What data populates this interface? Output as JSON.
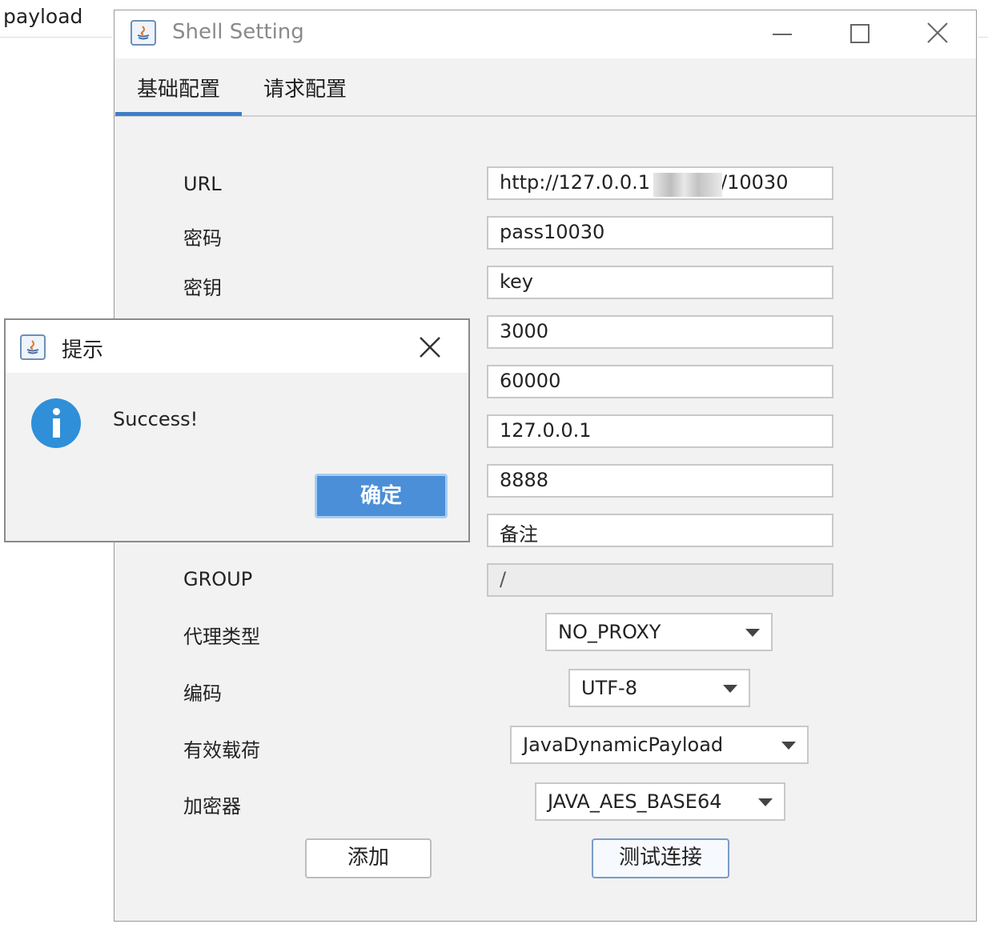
{
  "background": {
    "label": "payload"
  },
  "window": {
    "title": "Shell Setting",
    "tabs": [
      {
        "label": "基础配置",
        "active": true
      },
      {
        "label": "请求配置",
        "active": false
      }
    ]
  },
  "form": {
    "fields": [
      {
        "label": "URL",
        "value_prefix": "http://127.0.0.1",
        "value_suffix": "/10030"
      },
      {
        "label": "密码",
        "value": "pass10030"
      },
      {
        "label": "密钥",
        "value": "key"
      },
      {
        "label": "",
        "value": "3000"
      },
      {
        "label": "",
        "value": "60000"
      },
      {
        "label": "",
        "value": "127.0.0.1"
      },
      {
        "label": "",
        "value": "8888"
      },
      {
        "label": "",
        "value": "备注"
      },
      {
        "label": "GROUP",
        "value": "/"
      }
    ],
    "selects": [
      {
        "label": "代理类型",
        "value": "NO_PROXY"
      },
      {
        "label": "编码",
        "value": "UTF-8"
      },
      {
        "label": "有效载荷",
        "value": "JavaDynamicPayload"
      },
      {
        "label": "加密器",
        "value": "JAVA_AES_BASE64"
      }
    ],
    "buttons": {
      "add": "添加",
      "test": "测试连接"
    }
  },
  "dialog": {
    "title": "提示",
    "message": "Success!",
    "ok": "确定"
  },
  "colors": {
    "accent": "#3d7ec7",
    "ok_button": "#4a8fd8",
    "info_icon": "#2f8fd8"
  }
}
